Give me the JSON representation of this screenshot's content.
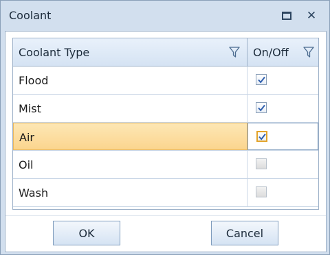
{
  "window": {
    "title": "Coolant",
    "maximize_icon": "maximize-icon",
    "close_icon": "close-icon",
    "close_glyph": "✕"
  },
  "grid": {
    "columns": [
      {
        "label": "Coolant Type",
        "icon": "filter-icon"
      },
      {
        "label": "On/Off",
        "icon": "filter-icon"
      }
    ],
    "rows": [
      {
        "type": "Flood",
        "on": true,
        "enabled": true,
        "selected": false
      },
      {
        "type": "Mist",
        "on": true,
        "enabled": true,
        "selected": false
      },
      {
        "type": "Air",
        "on": true,
        "enabled": true,
        "selected": true
      },
      {
        "type": "Oil",
        "on": false,
        "enabled": false,
        "selected": false
      },
      {
        "type": "Wash",
        "on": false,
        "enabled": false,
        "selected": false
      }
    ],
    "colors": {
      "selected_row": "#fbd58e",
      "check": "#2f5fae"
    }
  },
  "buttons": {
    "ok": "OK",
    "cancel": "Cancel"
  }
}
